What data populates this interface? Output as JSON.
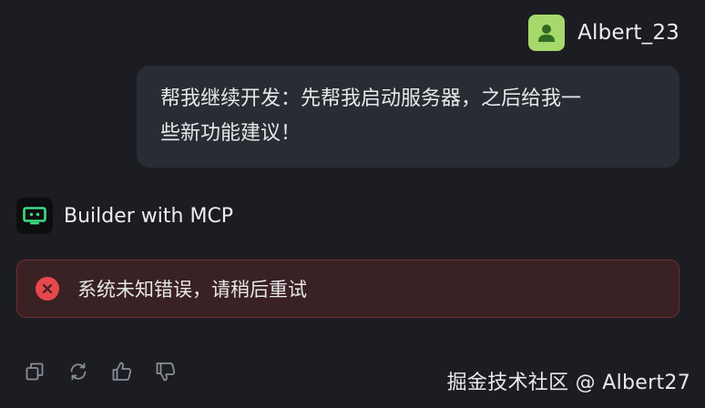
{
  "user": {
    "name": "Albert_23",
    "avatar_icon": "user-icon",
    "avatar_color": "#a6d86b",
    "message": "帮我继续开发：先帮我启动服务器，之后给我一些新功能建议！",
    "message_line1": "帮我继续开发：先帮我启动服务器，之后给我一",
    "message_line2": "些新功能建议！"
  },
  "bot": {
    "name": "Builder with MCP",
    "avatar_icon": "bot-icon",
    "accent_color": "#3ddc84"
  },
  "error": {
    "icon": "error-circle-icon",
    "text": "系统未知错误，请稍后重试",
    "color": "#e5484d"
  },
  "actions": [
    {
      "icon": "copy-icon"
    },
    {
      "icon": "regenerate-icon"
    },
    {
      "icon": "thumbs-up-icon"
    },
    {
      "icon": "thumbs-down-icon"
    }
  ],
  "watermark": "掘金技术社区 @ Albert27"
}
